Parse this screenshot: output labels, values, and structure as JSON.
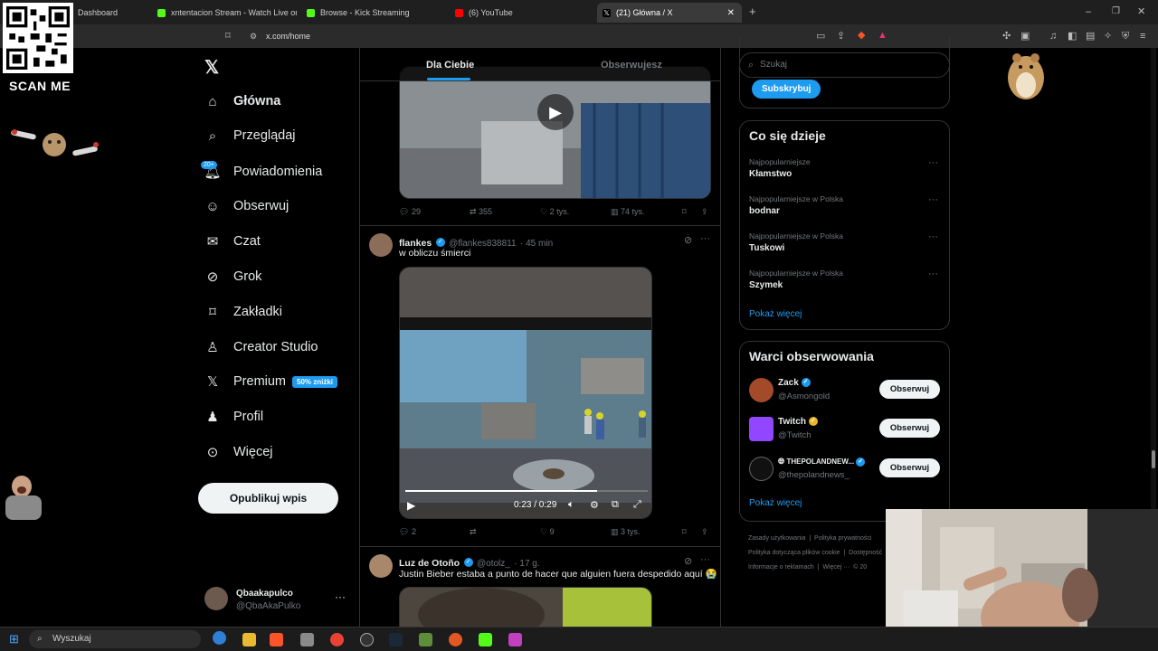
{
  "browser": {
    "tabs": [
      {
        "label": "Dashboard"
      },
      {
        "label": "xntentacion Stream - Watch Live on K"
      },
      {
        "label": "Browse - Kick Streaming"
      },
      {
        "label": "(6) YouTube"
      },
      {
        "label": "(21) Główna / X"
      }
    ],
    "new_tab": "+",
    "url": "x.com/home"
  },
  "overlay": {
    "scan_me": "SCAN ME"
  },
  "nav": {
    "items": [
      {
        "label": "Główna"
      },
      {
        "label": "Przeglądaj"
      },
      {
        "label": "Powiadomienia"
      },
      {
        "label": "Obserwuj"
      },
      {
        "label": "Czat"
      },
      {
        "label": "Grok"
      },
      {
        "label": "Zakładki"
      },
      {
        "label": "Creator Studio"
      },
      {
        "label": "Premium"
      },
      {
        "label": "Profil"
      },
      {
        "label": "Więcej"
      }
    ],
    "notif_badge": "20+",
    "premium_badge": "50% zniżki",
    "post_button": "Opublikuj wpis",
    "account": {
      "name": "Qbaakapulco",
      "handle": "@QbaAkaPulko"
    }
  },
  "feed": {
    "tabs": [
      "Dla Ciebie",
      "Obserwujesz"
    ],
    "tweet1_actions": {
      "replies": "29",
      "reposts": "355",
      "likes": "2 tys.",
      "views": "74 tys."
    },
    "tweet2": {
      "name": "flankes",
      "handle": "@flankes838811",
      "time": "· 45 min",
      "text": "w obliczu śmierci",
      "video_time": "0:23 / 0:29",
      "actions": {
        "replies": "2",
        "reposts": "",
        "likes": "9",
        "views": "3 tys."
      }
    },
    "tweet3": {
      "name": "Luz de Otoño",
      "handle": "@otolz_",
      "time": "· 17 g.",
      "text": "Justin Bieber estaba a punto de hacer que alguien fuera despedido aquí 😭"
    }
  },
  "right": {
    "search_placeholder": "Szukaj",
    "subscribe_button": "Subskrybuj",
    "trends_title": "Co się dzieje",
    "trends": [
      {
        "category": "Najpopularniejsze",
        "name": "Kłamstwo"
      },
      {
        "category": "Najpopularniejsze w Polska",
        "name": "bodnar"
      },
      {
        "category": "Najpopularniejsze w Polska",
        "name": "Tuskowi"
      },
      {
        "category": "Najpopularniejsze w Polska",
        "name": "Szymek"
      }
    ],
    "show_more": "Pokaż więcej",
    "who_to_follow_title": "Warci obserwowania",
    "who_to_follow": [
      {
        "name": "Zack",
        "handle": "@Asmongold",
        "button": "Obserwuj"
      },
      {
        "name": "Twitch",
        "handle": "@Twitch",
        "button": "Obserwuj"
      },
      {
        "name": "THEPOLANDNEW...",
        "handle": "@thepolandnews_",
        "button": "Obserwuj"
      }
    ],
    "footer": [
      "Zasady użytkowania",
      "|",
      "Polityka prywatności",
      "Polityka dotycząca plików cookie",
      "|",
      "Dostępność",
      "Informacje o reklamach",
      "|",
      "Więcej ···",
      "© 20"
    ]
  },
  "taskbar": {
    "search_placeholder": "Wyszukaj"
  },
  "colors": {
    "accent": "#1d9bf0",
    "background": "#000000",
    "border": "#2f3336",
    "muted": "#71767b"
  }
}
